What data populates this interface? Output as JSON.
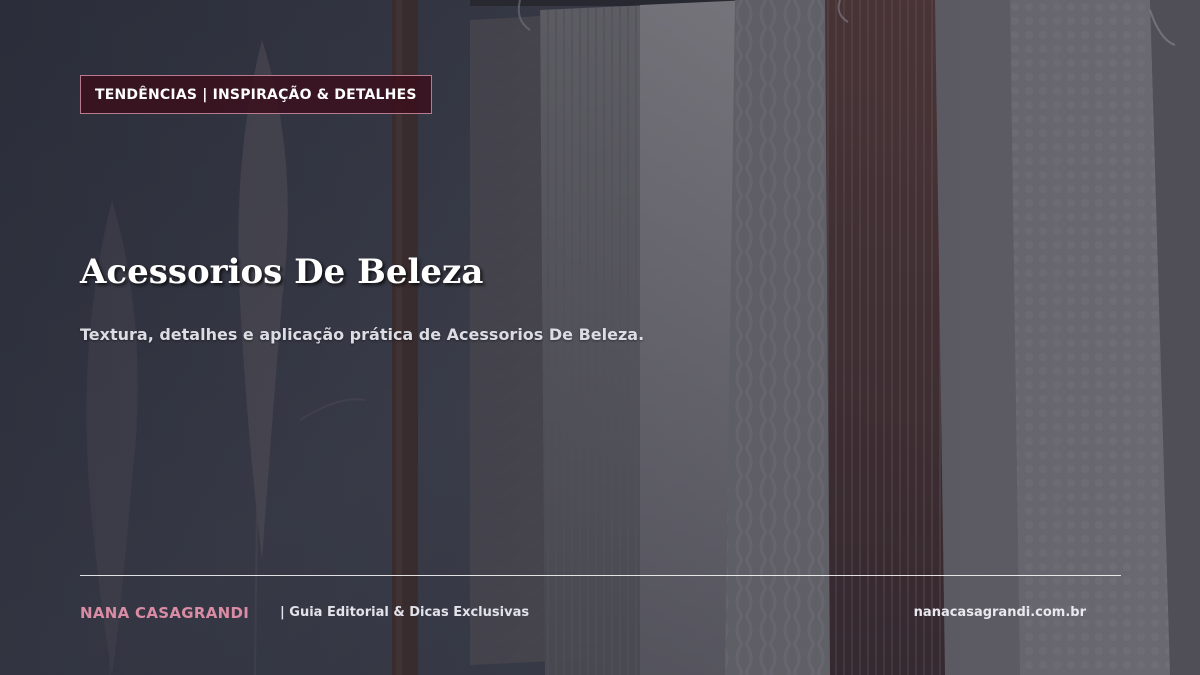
{
  "badge": {
    "label": "TENDÊNCIAS | INSPIRAÇÃO & DETALHES"
  },
  "hero": {
    "title": "Acessorios De Beleza",
    "subtitle": "Textura, detalhes e aplicação prática de Acessorios De Beleza."
  },
  "footer": {
    "brand": "NANA CASAGRANDI",
    "tagline": "| Guia Editorial & Dicas Exclusivas",
    "site": "nanacasagrandi.com.br"
  },
  "colors": {
    "badge_background": "#3a101e",
    "badge_border": "#b87a8e",
    "brand_accent": "#d98ca4",
    "background": "#2f323d"
  }
}
